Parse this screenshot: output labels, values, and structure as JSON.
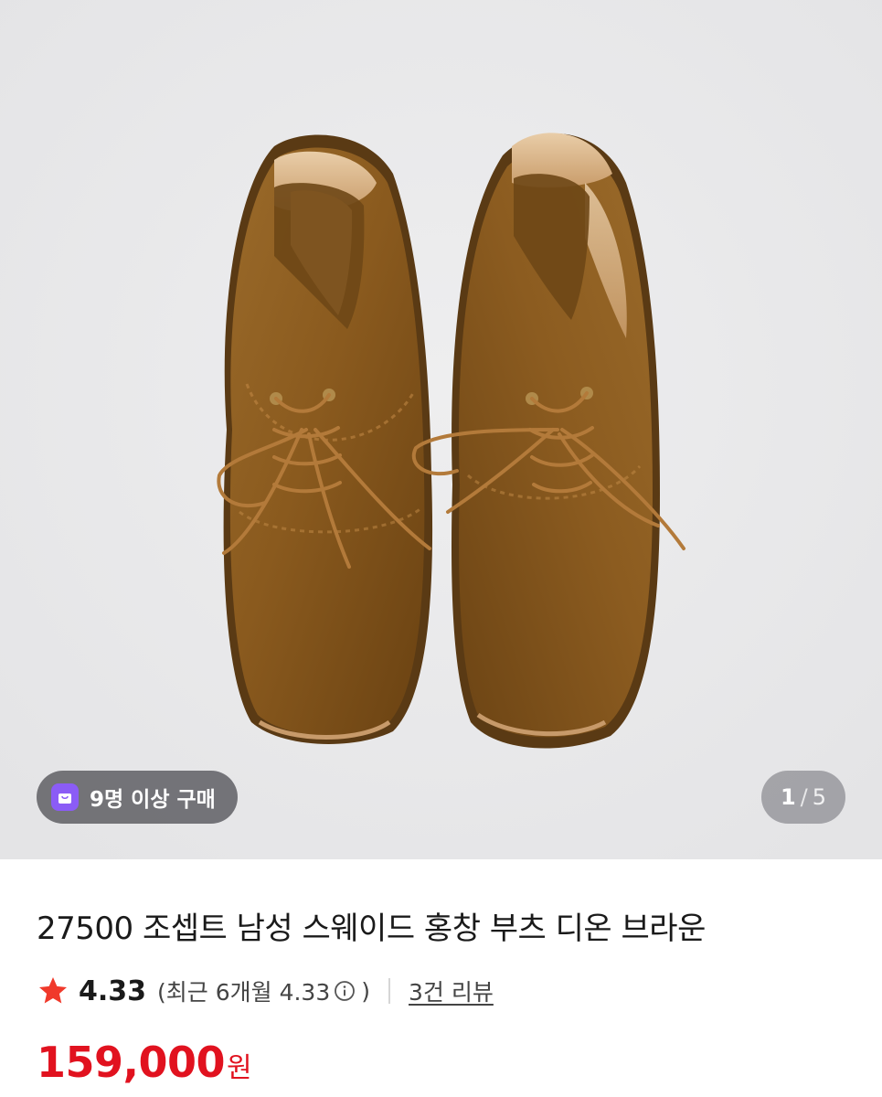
{
  "gallery": {
    "image_alt": "brown suede chukka boots top view",
    "buyers_badge": "9명 이상 구매",
    "current_index": "1",
    "separator": "/",
    "total_count": "5"
  },
  "product": {
    "title": "27500 조셉트 남성 스웨이드 홍창 부츠 디온 브라운",
    "rating_score": "4.33",
    "rating_recent_prefix": "(최근 6개월 4.33",
    "rating_recent_suffix": ")",
    "review_link": "3건 리뷰",
    "price": "159,000",
    "currency": "원"
  },
  "colors": {
    "price": "#e1121f",
    "star": "#f0392b",
    "badge_icon": "#8b5cf6",
    "suede": "#8a5a1e"
  },
  "icons": {
    "star": "star-icon",
    "info": "info-icon",
    "bag": "shopping-bag-icon"
  }
}
